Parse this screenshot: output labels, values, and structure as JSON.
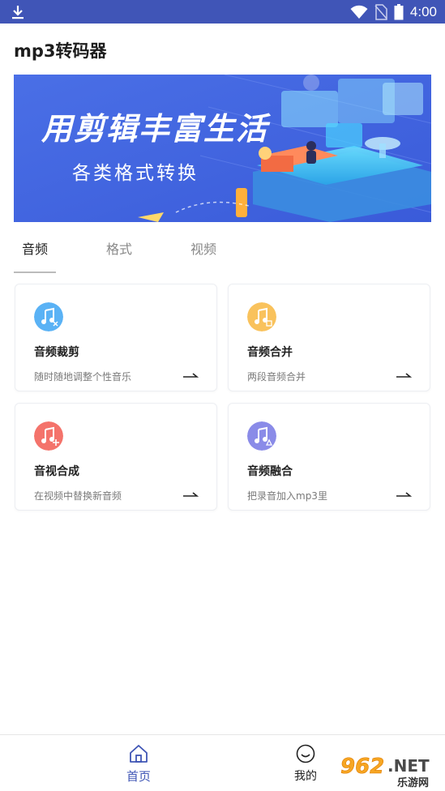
{
  "status_bar": {
    "time": "4:00",
    "bg_color": "#4055b7"
  },
  "app": {
    "title": "mp3转码器"
  },
  "banner": {
    "headline": "用剪辑丰富生活",
    "subline": "各类格式转换"
  },
  "tabs": [
    {
      "label": "音频",
      "active": true
    },
    {
      "label": "格式",
      "active": false
    },
    {
      "label": "视频",
      "active": false
    }
  ],
  "cards": [
    {
      "title": "音频裁剪",
      "desc": "随时随地调整个性音乐",
      "icon": "music-cut-icon",
      "color": "#5ab2f5"
    },
    {
      "title": "音频合并",
      "desc": "两段音频合并",
      "icon": "music-merge-icon",
      "color": "#f9c25c"
    },
    {
      "title": "音视合成",
      "desc": "在视频中替换新音频",
      "icon": "music-add-icon",
      "color": "#f4736b"
    },
    {
      "title": "音频融合",
      "desc": "把录音加入mp3里",
      "icon": "music-mix-icon",
      "color": "#8a8be8"
    }
  ],
  "bottom_nav": {
    "home_label": "首页",
    "mine_label": "我的",
    "active_color": "#3f55b5"
  },
  "watermark": {
    "text_main": "962",
    "text_suffix": ".NET",
    "text_sub": "乐游网"
  }
}
